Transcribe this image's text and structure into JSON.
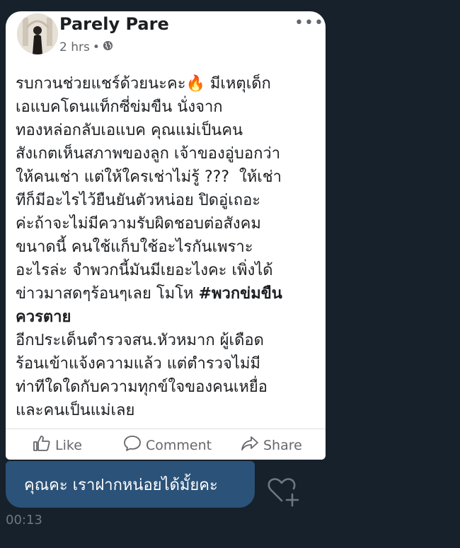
{
  "post": {
    "author": "Parely Pare",
    "time": "2 hrs",
    "separator": "•",
    "more_label": "•••",
    "lines": [
      "รบกวนช่วยแชร์ด้วยนะคะ🔥 มีเหตุเด็ก",
      "เอแบคโดนแท็กซี่ข่มขืน นั่งจาก",
      "ทองหล่อกลับเอแบค คุณแม่เป็นคน",
      "สังเกตเห็นสภาพของลูก เจ้าของอู่บอกว่า",
      "ให้คนเช่า แต่ให้ใครเช่าไม่รู้ ???  ให้เช่า",
      "ทีก็มีอะไรไว้ยืนยันตัวหน่อย ปิดอู่เถอะ",
      "ค่ะถ้าจะไม่มีความรับผิดชอบต่อสังคม",
      "ขนาดนี้ คนใช้แก็บใช้อะไรกันเพราะ",
      "อะไรล่ะ จำพวกนี้มันมีเยอะไงคะ เพิ่งได้",
      "ข่าวมาสดๆร้อนๆเลย โมโห "
    ],
    "hashtag_part1": "#พวกข่มขืน",
    "hashtag_part2": "ควรตาย",
    "lines2": [
      "อีกประเด็นตำรวจสน.หัวหมาก ผู้เดือด",
      "ร้อนเข้าแจ้งความแล้ว แต่ตำรวจไม่มี",
      "ท่าทีใดใดกับความทุกข์ใจของคนเหยื่อ",
      "และคนเป็นแม่เลย"
    ],
    "actions": {
      "like": "Like",
      "comment": "Comment",
      "share": "Share"
    }
  },
  "reply": {
    "text": "คุณคะ เราฝากหน่อยได้มั้ยคะ",
    "time": "00:13"
  },
  "colors": {
    "background": "#17212b",
    "reply_bubble": "#2b5278"
  }
}
